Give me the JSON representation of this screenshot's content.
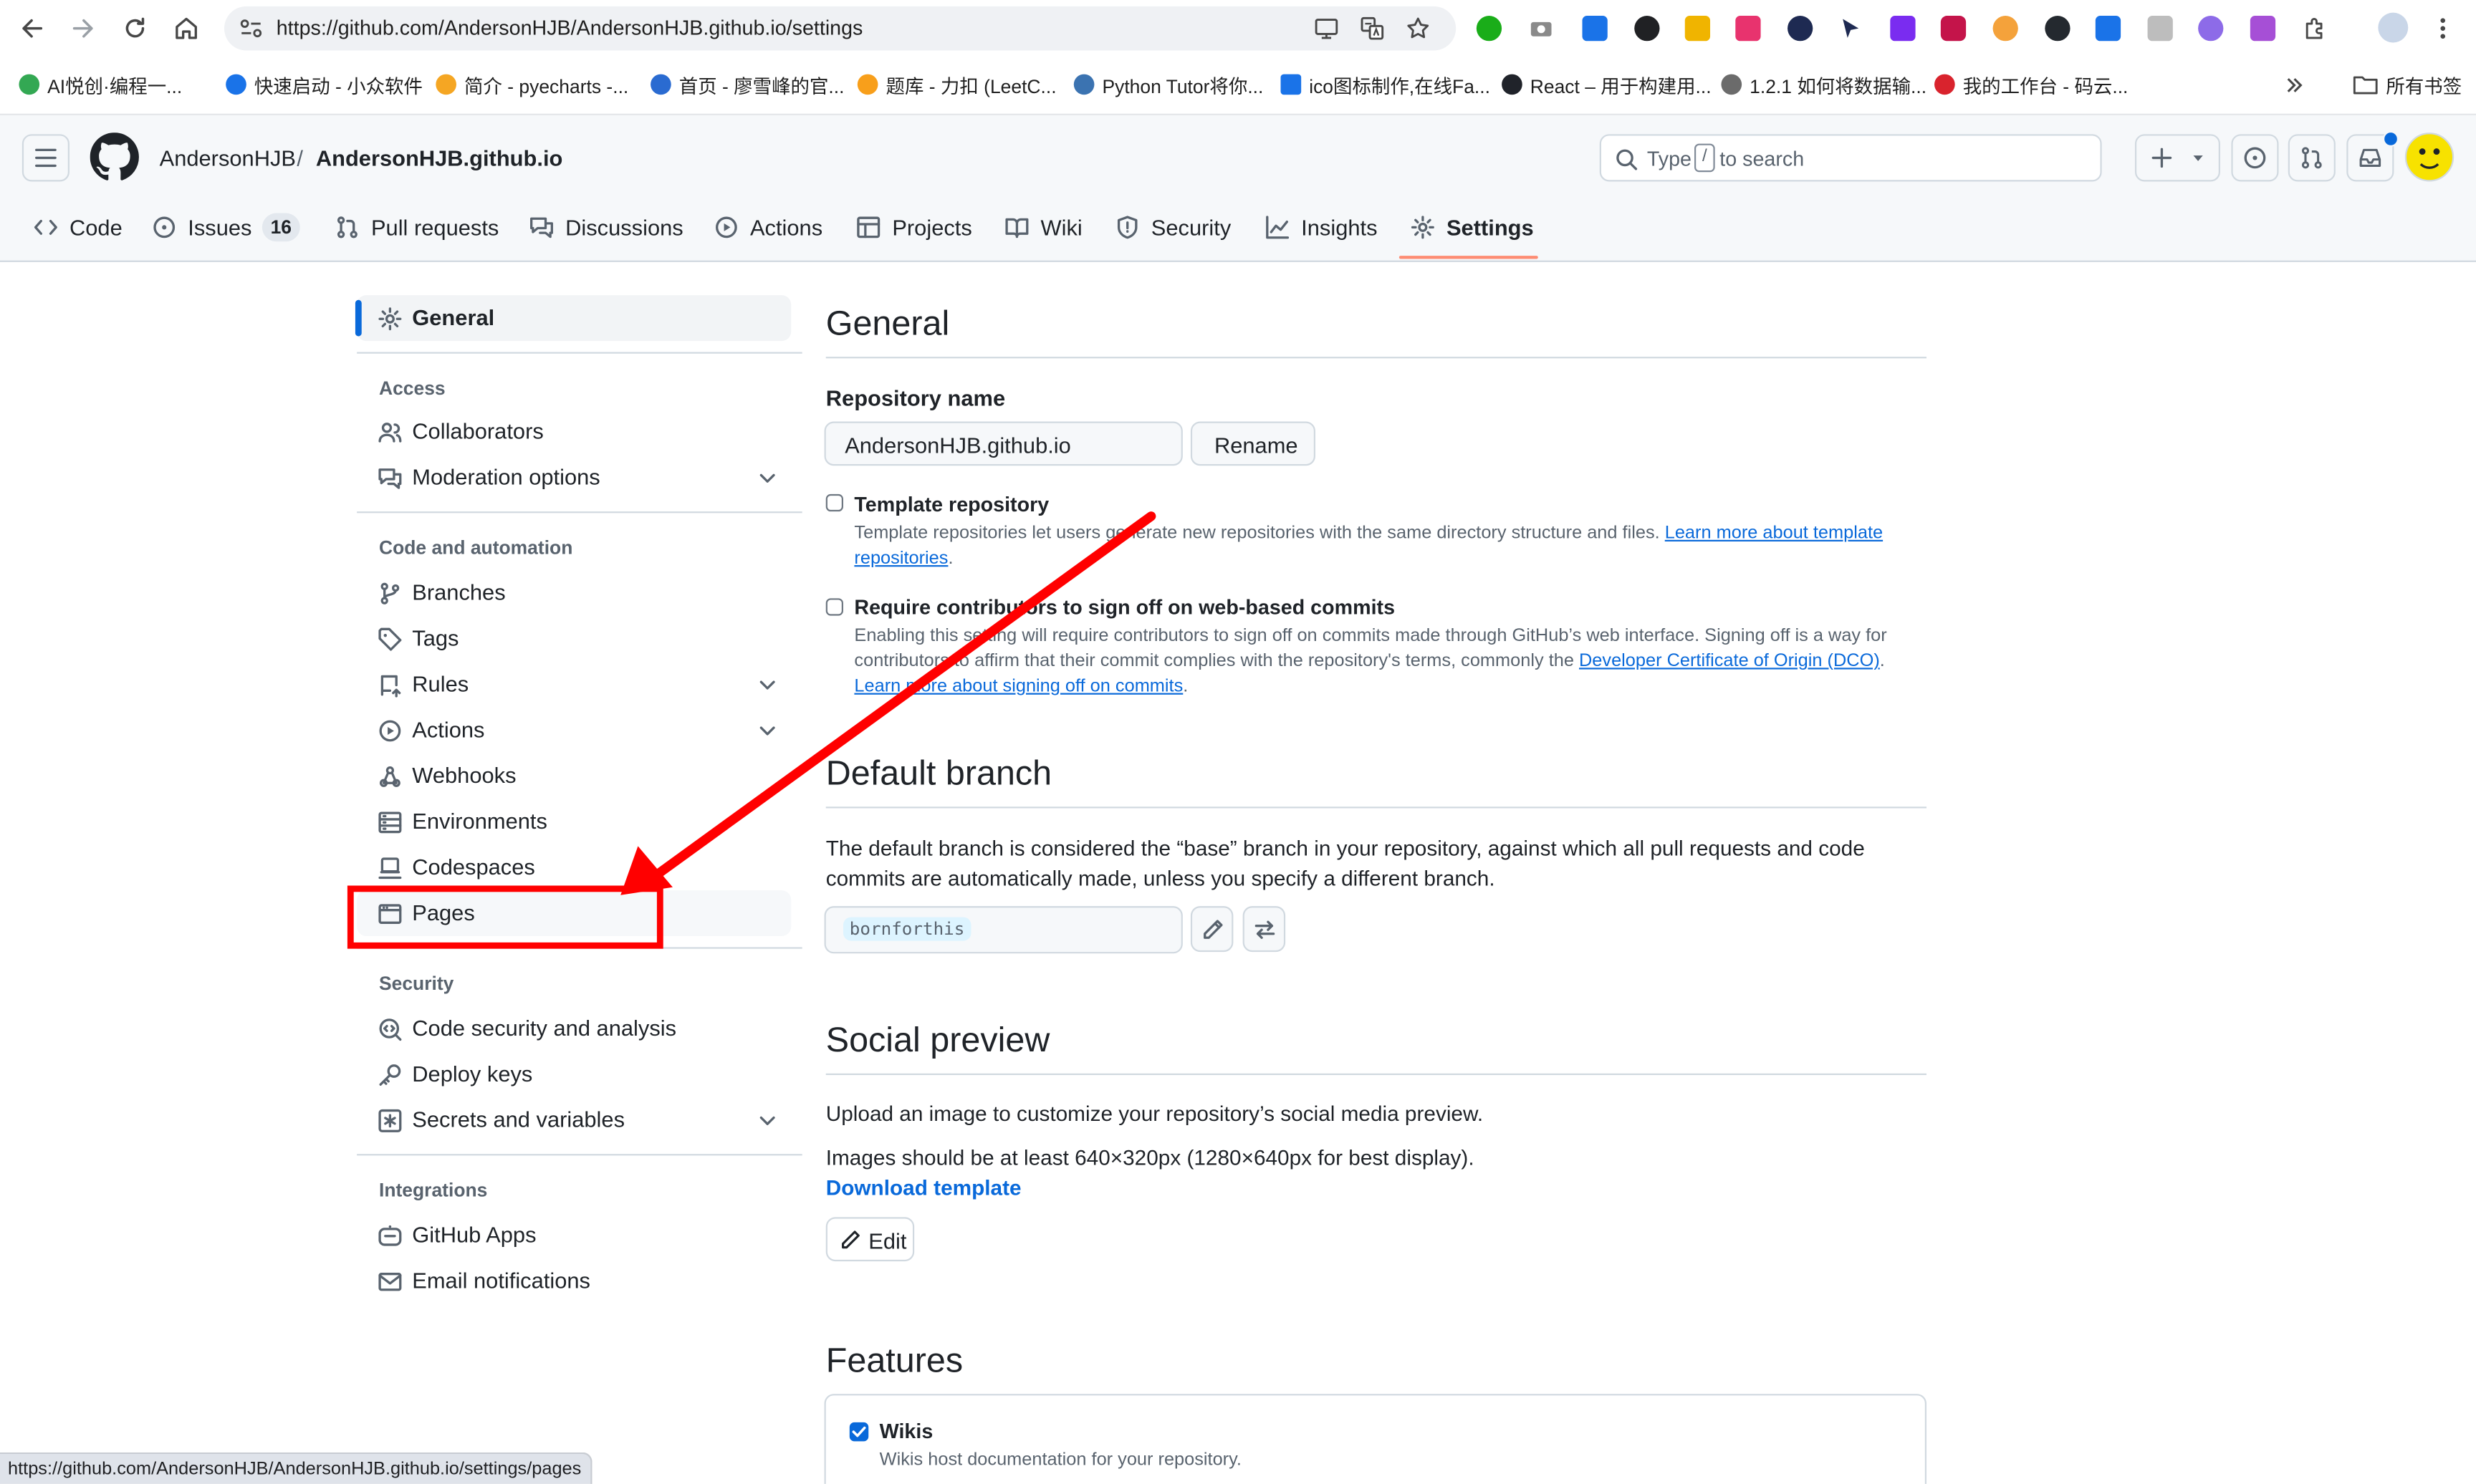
{
  "browser": {
    "url": "https://github.com/AndersonHJB/AndersonHJB.github.io/settings",
    "bookmarks": [
      "AI悦创·编程一...",
      "快速启动 - 小众软件",
      "简介 - pyecharts -...",
      "首页 - 廖雪峰的官...",
      "题库 - 力扣 (LeetC...",
      "Python Tutor将你...",
      "ico图标制作,在线Fa...",
      "React – 用于构建用...",
      "1.2.1 如何将数据输...",
      "我的工作台 - 码云..."
    ],
    "all_bookmarks": "所有书签",
    "status_url": "https://github.com/AndersonHJB/AndersonHJB.github.io/settings/pages"
  },
  "header": {
    "owner": "AndersonHJB",
    "separator": "/",
    "repo": "AndersonHJB.github.io",
    "search_prefix": "Type",
    "search_key": "/",
    "search_suffix": "to search"
  },
  "tabs": [
    {
      "label": "Code"
    },
    {
      "label": "Issues",
      "count": "16"
    },
    {
      "label": "Pull requests"
    },
    {
      "label": "Discussions"
    },
    {
      "label": "Actions"
    },
    {
      "label": "Projects"
    },
    {
      "label": "Wiki"
    },
    {
      "label": "Security"
    },
    {
      "label": "Insights"
    },
    {
      "label": "Settings",
      "selected": true
    }
  ],
  "sidebar": {
    "general": "General",
    "access_heading": "Access",
    "collaborators": "Collaborators",
    "moderation": "Moderation options",
    "code_heading": "Code and automation",
    "branches": "Branches",
    "tags": "Tags",
    "rules": "Rules",
    "actions": "Actions",
    "webhooks": "Webhooks",
    "environments": "Environments",
    "codespaces": "Codespaces",
    "pages": "Pages",
    "security_heading": "Security",
    "code_security": "Code security and analysis",
    "deploy_keys": "Deploy keys",
    "secrets": "Secrets and variables",
    "integrations_heading": "Integrations",
    "github_apps": "GitHub Apps",
    "email_notifications": "Email notifications"
  },
  "main": {
    "title": "General",
    "repo_name_label": "Repository name",
    "repo_name_value": "AndersonHJB.github.io",
    "rename": "Rename",
    "template_label": "Template repository",
    "template_desc": "Template repositories let users generate new repositories with the same directory structure and files.",
    "template_link": "Learn more about template repositories",
    "template_link_period": ".",
    "signoff_label": "Require contributors to sign off on web-based commits",
    "signoff_desc": "Enabling this setting will require contributors to sign off on commits made through GitHub’s web interface. Signing off is a way for contributors to affirm that their commit complies with the repository's terms, commonly the",
    "signoff_link1": "Developer Certificate of Origin (DCO)",
    "signoff_period": ".",
    "signoff_link2": "Learn more about signing off on commits",
    "signoff_period2": ".",
    "default_branch_title": "Default branch",
    "default_branch_desc": "The default branch is considered the “base” branch in your repository, against which all pull requests and code commits are automatically made, unless you specify a different branch.",
    "branch_name": "bornforthis",
    "social_title": "Social preview",
    "social_desc": "Upload an image to customize your repository’s social media preview.",
    "social_size": "Images should be at least 640×320px (1280×640px for best display).",
    "download_template": "Download template",
    "edit": "Edit",
    "features_title": "Features",
    "wikis_label": "Wikis",
    "wikis_desc": "Wikis host documentation for your repository."
  },
  "colors": {
    "annotation": "#ff0000",
    "accent": "#0969da",
    "underline": "#fd8c73"
  }
}
